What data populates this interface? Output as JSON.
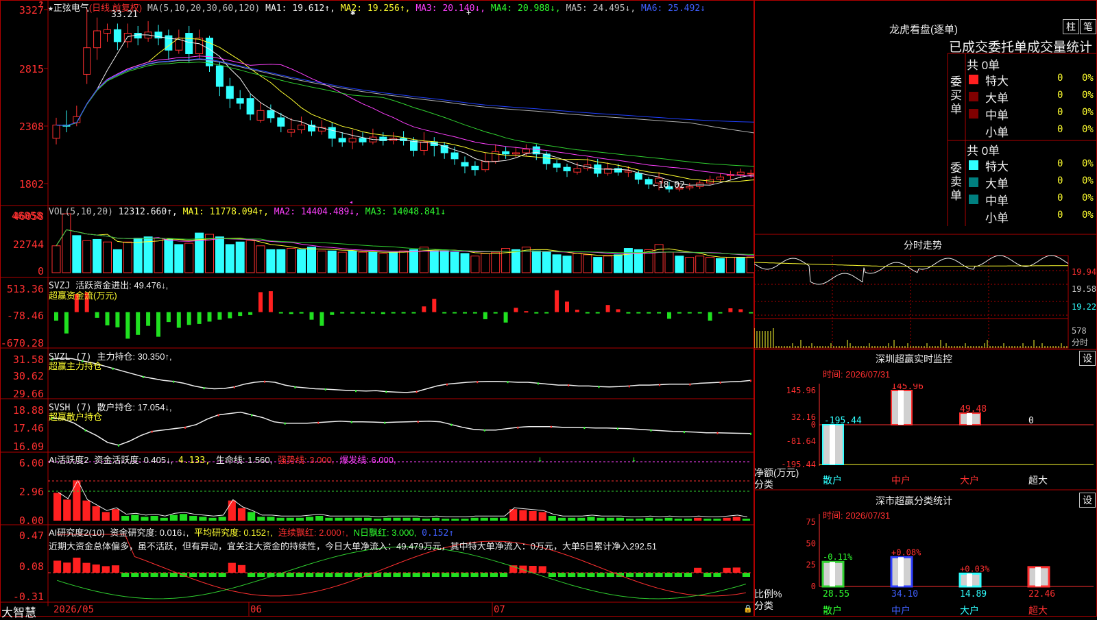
{
  "stock": {
    "name": "正弦电气",
    "period": "(日线,前复权)"
  },
  "ma_header": {
    "params": "MA(5,10,20,30,60,120)",
    "ma1": "MA1: 19.612↑,",
    "ma2": "MA2: 19.256↑,",
    "ma3": "MA3: 20.140↓,",
    "ma4": "MA4: 20.988↓,",
    "ma5": "MA5: 24.495↓,",
    "ma6": "MA6: 25.492↓"
  },
  "price_axis": [
    "3327",
    "2815",
    "2308",
    "1802"
  ],
  "price_marks": {
    "high": "33.21",
    "low": "←18.02"
  },
  "vol_header": {
    "params": "VOL(5,10,20)",
    "v": "12312.660↑,",
    "ma1": "MA1: 11778.094↑,",
    "ma2": "MA2: 14404.489↓,",
    "ma3": "MA3: 14048.841↓"
  },
  "vol_axis": [
    "46058",
    "22744",
    "0"
  ],
  "svzj_header": {
    "name": "SVZJ",
    "text": "活跃资金进出: 49.476↓,",
    "sub": "超赢资金流(万元)"
  },
  "svzj_axis": [
    "513.36",
    "-78.46",
    "-670.28"
  ],
  "svzl_header": {
    "name": "SVZL (7)",
    "text": "主力持仓: 30.350↑,",
    "sub": "超赢主力持仓"
  },
  "svzl_axis": [
    "31.58",
    "30.62",
    "29.66"
  ],
  "svsh_header": {
    "name": "SVSH (7)",
    "text": "散户持仓: 17.054↓,",
    "sub": "超赢散户持仓"
  },
  "svsh_axis": [
    "18.88",
    "17.46",
    "16.09"
  ],
  "ai1_header": {
    "name": "AI活跃度2",
    "a": "资金活跃度: 0.405↓,",
    "b": "4.133,",
    "c": "生命线: 1.560,",
    "d": "强势线: 3.000,",
    "e": "爆发线: 6.000,"
  },
  "ai1_axis": [
    "6.00",
    "2.96",
    "0.00"
  ],
  "ai2_header": {
    "name": "AI研究度2(10)",
    "a": "资金研究度: 0.016↓,",
    "b": "平均研究度: 0.152↑,",
    "c": "连续飘红: 2.000↑,",
    "d": "N日飘红: 3.000,",
    "e": "0.152↑"
  },
  "ai2_comment": "近期大资金总体偏多，虽不活跃，但有异动，宜关注大资金的持续性，今日大单净流入：49.479万元，其中特大单净流入：0万元，大单5日累计净入292.51",
  "ai2_axis": [
    "0.47",
    "0.08",
    "-0.31"
  ],
  "date_axis": [
    "2026/05",
    "06",
    "07"
  ],
  "brand": "大智慧",
  "right": {
    "lhb_title": "龙虎看盘(逐单)",
    "btn_zhu": "柱",
    "btn_bi": "笔",
    "tabs": "已成交委托单成交量统计",
    "buy_total": "共 0单",
    "sell_total": "共 0单",
    "buy_label": "委买单",
    "sell_label": "委卖单",
    "rows": [
      {
        "name": "特大",
        "v": "0",
        "p": "0%"
      },
      {
        "name": "大单",
        "v": "0",
        "p": "0%"
      },
      {
        "name": "中单",
        "v": "0",
        "p": "0%"
      },
      {
        "name": "小单",
        "v": "0",
        "p": "0%"
      }
    ],
    "intraday_title": "分时走势",
    "intraday_axis": [
      "19.94",
      "19.58",
      "19.22",
      "578",
      "分时"
    ],
    "monitor_title": "深圳超赢实时监控",
    "monitor_btn": "设",
    "monitor_time": "时间: 2026/07/31",
    "monitor_axis": [
      "145.96",
      "32.16",
      "0",
      "-81.64",
      "-195.44"
    ],
    "monitor_axis_label": "净额(万元)",
    "monitor_cat_label": "分类",
    "monitor_bars": [
      {
        "name": "散户",
        "value": -195.44,
        "label": "-195.44"
      },
      {
        "name": "中户",
        "value": 145.96,
        "label": "145.96"
      },
      {
        "name": "大户",
        "value": 49.48,
        "label": "49.48"
      },
      {
        "name": "超大",
        "value": 0,
        "label": "0"
      }
    ],
    "class_title": "深市超赢分类统计",
    "class_btn": "设",
    "class_time": "时间: 2026/07/31",
    "class_axis": [
      "75",
      "50",
      "25",
      "0"
    ],
    "class_axis_label": "比例%",
    "class_cat_label": "分类",
    "class_bars": [
      {
        "name": "散户",
        "value": 28.55,
        "label": "28.55",
        "change": "-0.11%",
        "color": "#30d030"
      },
      {
        "name": "中户",
        "value": 34.1,
        "label": "34.10",
        "change": "+0.08%",
        "color": "#3040ff"
      },
      {
        "name": "大户",
        "value": 14.89,
        "label": "14.89",
        "change": "+0.03%",
        "color": "#30ffff"
      },
      {
        "name": "超大",
        "value": 22.46,
        "label": "22.46",
        "change": "",
        "color": "#ff3030"
      }
    ]
  },
  "chart_data": [
    {
      "type": "candlestick",
      "title": "正弦电气 (日线,前复权)",
      "ylim": [
        17.5,
        33.5
      ],
      "candles": [
        [
          22.5,
          23.6,
          24.2,
          22.0
        ],
        [
          23.6,
          23.5,
          24.8,
          23.0
        ],
        [
          23.8,
          24.3,
          25.2,
          23.5
        ],
        [
          27.8,
          30.0,
          33.21,
          27.0
        ],
        [
          30.0,
          31.4,
          32.5,
          29.0
        ],
        [
          31.2,
          31.5,
          32.0,
          30.5
        ],
        [
          31.5,
          30.5,
          32.0,
          29.8
        ],
        [
          30.5,
          31.2,
          32.0,
          30.0
        ],
        [
          31.2,
          30.8,
          31.8,
          30.2
        ],
        [
          30.8,
          31.3,
          32.2,
          30.5
        ],
        [
          31.3,
          30.8,
          31.9,
          30.2
        ],
        [
          31.0,
          29.8,
          31.5,
          29.0
        ],
        [
          29.8,
          30.8,
          31.5,
          29.5
        ],
        [
          31.2,
          29.5,
          31.8,
          28.8
        ],
        [
          29.5,
          30.8,
          31.5,
          29.0
        ],
        [
          30.8,
          28.5,
          31.0,
          28.0
        ],
        [
          28.5,
          26.8,
          28.8,
          26.0
        ],
        [
          26.8,
          25.8,
          27.5,
          25.0
        ],
        [
          25.8,
          25.4,
          26.5,
          24.9
        ],
        [
          25.8,
          24.5,
          26.2,
          24.0
        ],
        [
          24.0,
          24.8,
          25.5,
          23.8
        ],
        [
          24.8,
          24.2,
          25.3,
          23.8
        ],
        [
          24.2,
          23.5,
          24.6,
          23.0
        ],
        [
          23.0,
          23.2,
          24.2,
          22.6
        ],
        [
          23.2,
          23.6,
          24.3,
          22.9
        ],
        [
          23.6,
          23.1,
          24.0,
          22.7
        ],
        [
          23.1,
          23.4,
          24.0,
          22.8
        ],
        [
          23.4,
          22.5,
          23.8,
          21.8
        ],
        [
          22.5,
          22.2,
          23.0,
          21.8
        ],
        [
          22.2,
          22.5,
          23.2,
          21.6
        ],
        [
          22.5,
          22.2,
          23.0,
          21.9
        ],
        [
          22.2,
          22.6,
          23.3,
          22.0
        ],
        [
          22.6,
          22.3,
          23.0,
          21.9
        ],
        [
          22.3,
          22.5,
          23.0,
          22.0
        ],
        [
          22.5,
          22.3,
          23.1,
          21.9
        ],
        [
          22.3,
          21.5,
          22.6,
          21.0
        ],
        [
          21.5,
          22.2,
          23.0,
          21.1
        ],
        [
          22.2,
          21.9,
          22.6,
          21.0
        ],
        [
          21.9,
          21.3,
          22.2,
          20.8
        ],
        [
          21.3,
          20.8,
          21.8,
          20.3
        ],
        [
          20.5,
          20.2,
          21.0,
          19.6
        ],
        [
          20.2,
          19.9,
          20.6,
          19.4
        ],
        [
          19.9,
          20.6,
          21.3,
          19.7
        ],
        [
          20.6,
          21.4,
          22.0,
          20.4
        ],
        [
          21.4,
          21.2,
          21.8,
          20.8
        ],
        [
          21.2,
          21.3,
          21.8,
          20.9
        ],
        [
          21.3,
          21.6,
          22.0,
          21.0
        ],
        [
          21.8,
          21.2,
          22.0,
          20.7
        ],
        [
          21.2,
          20.4,
          21.4,
          19.9
        ],
        [
          20.4,
          20.1,
          20.7,
          19.7
        ],
        [
          20.1,
          19.8,
          20.4,
          19.3
        ],
        [
          19.7,
          20.0,
          20.5,
          19.5
        ],
        [
          20.0,
          20.3,
          20.9,
          19.8
        ],
        [
          20.3,
          19.6,
          20.8,
          19.3
        ],
        [
          19.6,
          20.0,
          20.5,
          19.4
        ],
        [
          20.0,
          19.7,
          20.4,
          19.4
        ],
        [
          19.7,
          19.8,
          20.2,
          19.3
        ],
        [
          19.6,
          19.1,
          19.8,
          18.7
        ],
        [
          19.1,
          18.7,
          19.3,
          18.3
        ],
        [
          18.8,
          19.2,
          19.7,
          18.2
        ],
        [
          18.5,
          18.3,
          18.9,
          18.02
        ],
        [
          18.3,
          18.4,
          18.7,
          18.1
        ],
        [
          18.4,
          18.5,
          18.8,
          18.2
        ],
        [
          18.5,
          18.8,
          19.0,
          18.3
        ],
        [
          18.8,
          19.1,
          19.4,
          18.6
        ],
        [
          19.1,
          19.3,
          19.6,
          18.9
        ],
        [
          19.4,
          19.5,
          19.8,
          19.1
        ],
        [
          19.5,
          19.7,
          20.0,
          19.2
        ],
        [
          19.6,
          19.6,
          19.9,
          19.2
        ],
        [
          19.6,
          19.6,
          19.8,
          19.3
        ]
      ],
      "ma_series": [
        {
          "name": "MA1",
          "value": 19.612,
          "color": "#f0f0f0"
        },
        {
          "name": "MA2",
          "value": 19.256,
          "color": "#ffff30"
        },
        {
          "name": "MA3",
          "value": 20.14,
          "color": "#ff40ff"
        },
        {
          "name": "MA4",
          "value": 20.988,
          "color": "#30d030"
        },
        {
          "name": "MA5",
          "value": 24.495,
          "color": "#b0b0b0"
        },
        {
          "name": "MA6",
          "value": 25.492,
          "color": "#2040ff"
        }
      ]
    },
    {
      "type": "bar",
      "title": "VOL(5,10,20)",
      "ylim": [
        0,
        46058
      ],
      "values": [
        21000,
        46058,
        29000,
        25000,
        26000,
        24000,
        18000,
        24000,
        27000,
        28000,
        27000,
        26000,
        22000,
        23000,
        31000,
        30000,
        28000,
        22000,
        24000,
        25000,
        21000,
        18000,
        18000,
        19000,
        18000,
        20000,
        17000,
        17000,
        16000,
        17000,
        16000,
        16000,
        15000,
        16000,
        17000,
        18000,
        20000,
        17000,
        17000,
        16000,
        15000,
        13000,
        15000,
        16000,
        19000,
        18000,
        20000,
        17000,
        16000,
        14000,
        13000,
        15000,
        14000,
        12000,
        13000,
        14000,
        19000,
        18000,
        18000,
        22000,
        16000,
        13000,
        12000,
        13000,
        12000,
        11000,
        12000,
        12000,
        12312,
        12000
      ],
      "up": [
        1,
        1,
        0,
        1,
        0,
        1,
        0,
        1,
        0,
        0,
        1,
        0,
        0,
        1,
        0,
        1,
        0,
        0,
        0,
        1,
        1,
        0,
        0,
        1,
        0,
        0,
        1,
        0,
        1,
        0,
        1,
        0,
        1,
        0,
        1,
        0,
        1,
        0,
        0,
        0,
        0,
        1,
        1,
        1,
        1,
        0,
        1,
        0,
        0,
        0,
        0,
        1,
        1,
        0,
        1,
        0,
        0,
        0,
        1,
        1,
        1,
        0,
        1,
        1,
        1,
        0,
        1,
        0,
        1,
        0
      ]
    },
    {
      "type": "bar",
      "title": "SVZJ 活跃资金进出",
      "ylim": [
        -670.28,
        513.36
      ],
      "values": [
        -180,
        -450,
        380,
        420,
        -120,
        -280,
        -320,
        -560,
        -480,
        -290,
        -520,
        -210,
        -330,
        -270,
        -250,
        -200,
        -160,
        -130,
        -80,
        -60,
        420,
        440,
        -20,
        -40,
        -30,
        -160,
        -290,
        -60,
        -20,
        -30,
        -30,
        -20,
        -40,
        -10,
        -20,
        -20,
        120,
        280,
        -20,
        -20,
        -30,
        -30,
        -150,
        -30,
        -220,
        90,
        20,
        -30,
        -20,
        460,
        220,
        50,
        -20,
        -20,
        150,
        60,
        -30,
        -20,
        -30,
        -20,
        -140,
        -30,
        -20,
        -20,
        -180,
        -20,
        80,
        60,
        -20,
        40
      ],
      "color_up": "#ff2020",
      "color_down": "#20e020"
    },
    {
      "type": "line",
      "title": "SVZL 主力持仓",
      "ylim": [
        29.66,
        31.58
      ],
      "values": [
        31.5,
        31.55,
        31.52,
        31.4,
        31.3,
        31.15,
        31.0,
        30.85,
        30.7,
        30.55,
        30.45,
        30.35,
        30.3,
        30.2,
        30.05,
        29.95,
        29.9,
        29.92,
        30.0,
        30.15,
        30.25,
        30.3,
        30.25,
        30.1,
        30.0,
        29.95,
        29.9,
        29.88,
        29.85,
        29.82,
        29.8,
        29.78,
        29.8,
        29.75,
        29.72,
        29.7,
        29.75,
        29.9,
        30.05,
        30.15,
        30.2,
        30.25,
        30.28,
        30.3,
        30.3,
        30.28,
        30.25,
        30.25,
        30.2,
        30.15,
        30.1,
        30.1,
        30.05,
        30.05,
        30.02,
        30.0,
        30.02,
        30.05,
        30.1,
        30.1,
        30.12,
        30.15,
        30.15,
        30.15,
        30.2,
        30.22,
        30.25,
        30.28,
        30.3,
        30.35
      ]
    },
    {
      "type": "line",
      "title": "SVSH 散户持仓",
      "ylim": [
        16.09,
        18.88
      ],
      "values": [
        18.2,
        18.1,
        17.8,
        17.3,
        16.9,
        16.4,
        16.2,
        16.5,
        16.9,
        17.2,
        17.3,
        17.4,
        17.5,
        17.7,
        18.1,
        18.4,
        18.5,
        18.6,
        18.4,
        18.2,
        17.9,
        17.8,
        17.8,
        17.8,
        17.85,
        17.9,
        17.95,
        17.9,
        17.9,
        17.88,
        17.85,
        17.88,
        17.9,
        17.92,
        17.95,
        17.9,
        17.7,
        17.5,
        17.35,
        17.3,
        17.3,
        17.4,
        17.5,
        17.55,
        17.55,
        17.55,
        17.5,
        17.5,
        17.48,
        17.45,
        17.45,
        17.42,
        17.4,
        17.35,
        17.3,
        17.25,
        17.2,
        17.18,
        17.15,
        17.1,
        17.1,
        17.08,
        17.06,
        17.05
      ]
    },
    {
      "type": "bar",
      "title": "AI活跃度2",
      "ylim": [
        0,
        6.0
      ],
      "values": [
        2.9,
        2.2,
        4.2,
        2.1,
        1.5,
        0.9,
        1.2,
        0.5,
        0.6,
        0.4,
        0.5,
        0.3,
        0.6,
        0.7,
        0.5,
        0.4,
        0.3,
        0.4,
        2.1,
        1.3,
        0.9,
        0.4,
        0.4,
        0.3,
        0.3,
        0.3,
        0.4,
        0.5,
        0.3,
        0.3,
        0.3,
        0.3,
        0.3,
        0.2,
        0.3,
        0.3,
        0.3,
        0.3,
        0.2,
        0.3,
        0.2,
        0.2,
        0.2,
        0.3,
        0.3,
        0.3,
        0.3,
        1.2,
        1.1,
        1.0,
        0.9,
        0.5,
        0.3,
        0.3,
        0.3,
        0.4,
        0.3,
        0.3,
        0.3,
        0.2,
        0.2,
        0.3,
        0.2,
        0.3,
        0.2,
        0.2,
        0.3,
        0.2,
        0.2,
        0.3,
        0.4,
        0.2
      ],
      "red": [
        1,
        1,
        1,
        1,
        1,
        1,
        1,
        0,
        0,
        0,
        0,
        0,
        0,
        0,
        0,
        0,
        0,
        0,
        1,
        1,
        0,
        0,
        0,
        0,
        0,
        0,
        0,
        0,
        0,
        0,
        0,
        0,
        0,
        0,
        0,
        0,
        0,
        0,
        0,
        0,
        0,
        0,
        0,
        0,
        0,
        0,
        0,
        1,
        1,
        1,
        1,
        0,
        0,
        0,
        0,
        0,
        0,
        0,
        0,
        0,
        0,
        0,
        0,
        0,
        0,
        0,
        1,
        0,
        0,
        1,
        1,
        0
      ]
    }
  ]
}
